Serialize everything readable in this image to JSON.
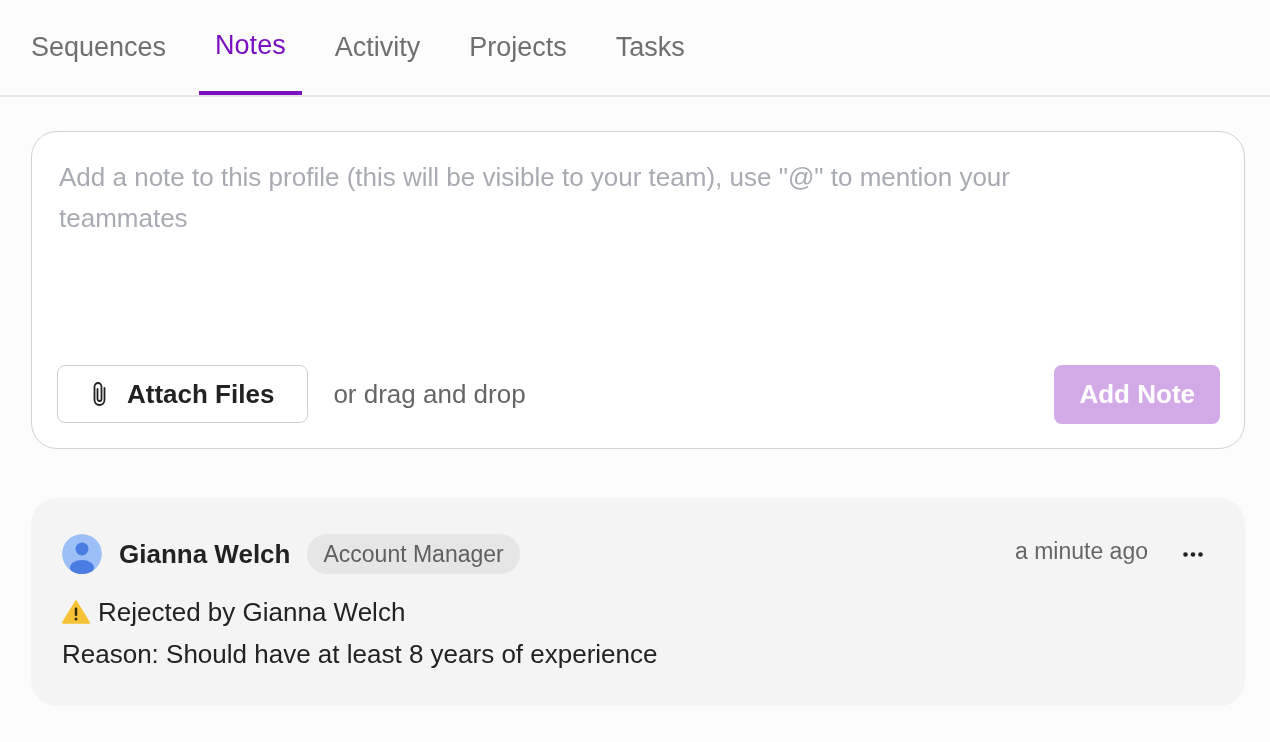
{
  "tabs": [
    {
      "label": "Sequences",
      "selected": false
    },
    {
      "label": "Notes",
      "selected": true
    },
    {
      "label": "Activity",
      "selected": false
    },
    {
      "label": "Projects",
      "selected": false
    },
    {
      "label": "Tasks",
      "selected": false
    }
  ],
  "composer": {
    "placeholder": "Add a note to this profile (this will be visible to your team), use \"@\" to mention your teammates",
    "attach_button": "Attach Files",
    "drop_hint": "or drag and drop",
    "submit_button": {
      "label": "Add Note",
      "disabled": true
    }
  },
  "notes": [
    {
      "author": "Gianna Welch",
      "role": "Account Manager",
      "time": "a minute ago",
      "status": {
        "kind": "warning",
        "text": "Rejected by Gianna Welch"
      },
      "body": "Reason: Should have at least 8 years of experience"
    }
  ]
}
